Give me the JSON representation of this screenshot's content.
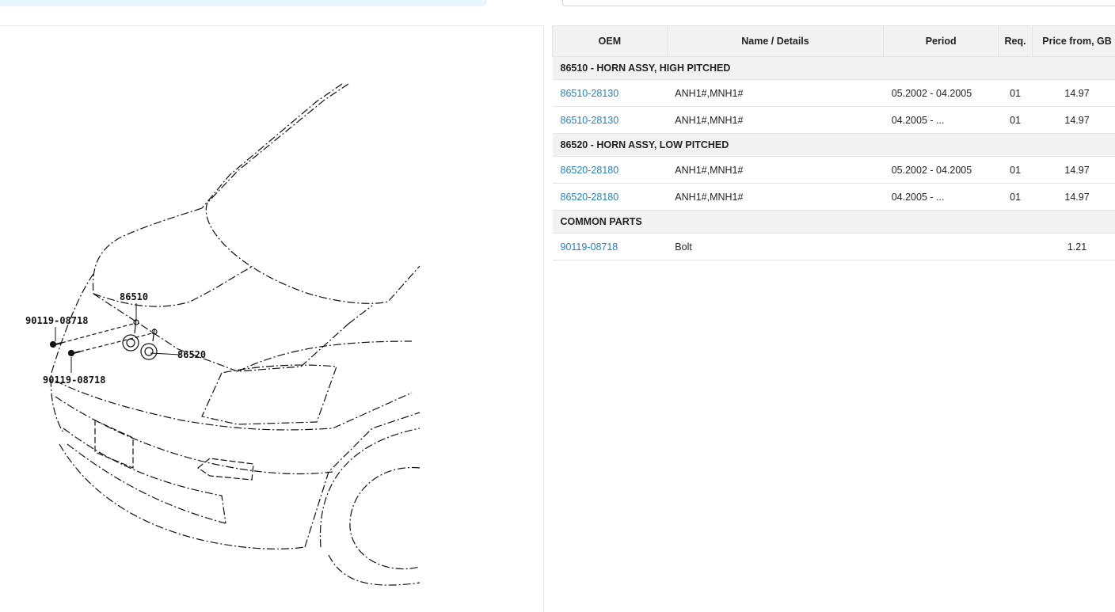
{
  "table": {
    "headers": {
      "oem": "OEM",
      "name": "Name / Details",
      "period": "Period",
      "req": "Req.",
      "price": "Price from, GB"
    },
    "groups": [
      {
        "title": "86510 - HORN ASSY, HIGH PITCHED",
        "rows": [
          {
            "oem": "86510-28130",
            "name": "ANH1#,MNH1#",
            "period": "05.2002 - 04.2005",
            "req": "01",
            "price": "14.97"
          },
          {
            "oem": "86510-28130",
            "name": "ANH1#,MNH1#",
            "period": "04.2005 - ...",
            "req": "01",
            "price": "14.97"
          }
        ]
      },
      {
        "title": "86520 - HORN ASSY, LOW PITCHED",
        "rows": [
          {
            "oem": "86520-28180",
            "name": "ANH1#,MNH1#",
            "period": "05.2002 - 04.2005",
            "req": "01",
            "price": "14.97"
          },
          {
            "oem": "86520-28180",
            "name": "ANH1#,MNH1#",
            "period": "04.2005 - ...",
            "req": "01",
            "price": "14.97"
          }
        ]
      },
      {
        "title": "COMMON PARTS",
        "rows": [
          {
            "oem": "90119-08718",
            "name": "Bolt",
            "period": "",
            "req": "",
            "price": "1.21"
          }
        ]
      }
    ]
  },
  "diagram": {
    "callouts": {
      "high_horn": "86510",
      "low_horn": "86520",
      "bolt_upper": "90119-08718",
      "bolt_lower": "90119-08718"
    }
  },
  "colors": {
    "link": "#2a7fb0",
    "header_bg": "#f2f2f2"
  }
}
